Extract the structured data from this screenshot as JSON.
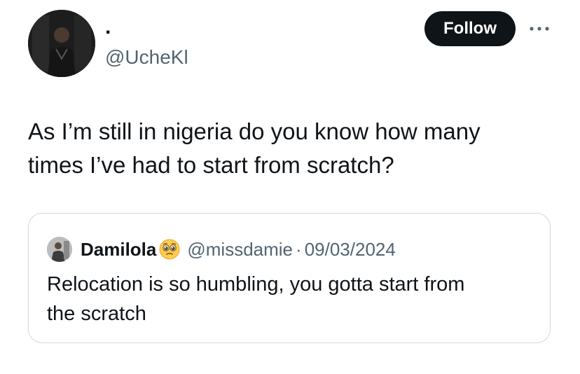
{
  "author": {
    "display_name": ".",
    "handle": "@UcheKl"
  },
  "actions": {
    "follow_label": "Follow",
    "more_icon": "more-horizontal-icon"
  },
  "tweet": {
    "text": "As I’m still in nigeria do you know how many\ntimes I’ve had to start from scratch?"
  },
  "quote": {
    "name": "Damilola",
    "emoji_icon": "pleading-face-icon",
    "handle": "@missdamie",
    "separator": "·",
    "date": "09/03/2024",
    "text": "Relocation is so humbling, you gotta start from\nthe scratch"
  },
  "colors": {
    "text_primary": "#0f1419",
    "text_secondary": "#536471",
    "button_bg": "#0f1419",
    "border": "#cfd9de"
  }
}
